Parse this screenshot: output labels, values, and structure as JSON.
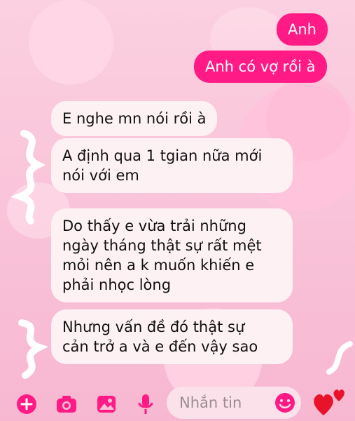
{
  "messages": [
    {
      "side": "outgoing",
      "text": "Anh"
    },
    {
      "side": "outgoing",
      "text": "Anh có vợ rồi à"
    },
    {
      "side": "incoming",
      "text": "E nghe mn nói rồi à"
    },
    {
      "side": "incoming",
      "text": "A định qua 1 tgian nữa mới\nnói với em"
    },
    {
      "side": "incoming",
      "text": "Do thấy e vừa trải những\nngày tháng thật sự rất mệt\nmỏi nên a k muốn khiến e\nphải nhọc lòng"
    },
    {
      "side": "incoming",
      "text": "Nhưng vấn đề đó thật sự\ncản trở a và e đến vậy sao"
    }
  ],
  "composer": {
    "placeholder": "Nhắn tin",
    "icons": [
      "add-icon",
      "camera-icon",
      "gallery-icon",
      "microphone-icon",
      "emoji-icon",
      "heart-reaction-icon"
    ]
  },
  "colors": {
    "accent": "#ff1a86",
    "incoming_bubble": "#fdf1f4",
    "background": "#f9c2d8"
  }
}
